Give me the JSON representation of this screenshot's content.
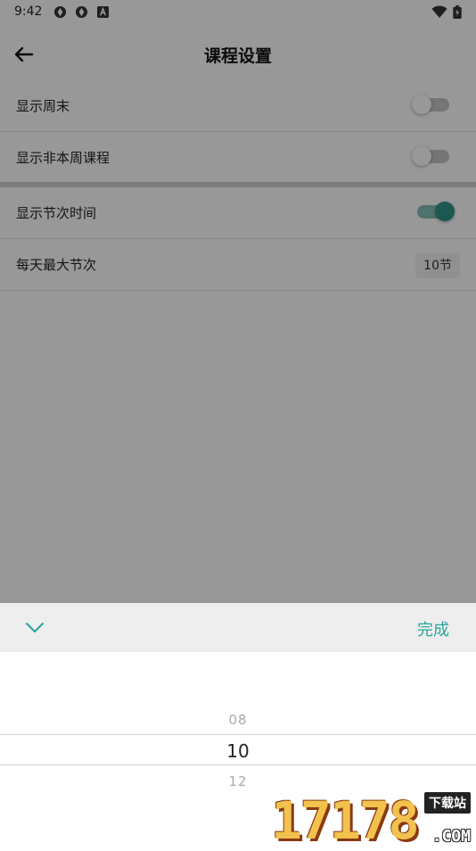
{
  "status_bar": {
    "time": "9:42",
    "icons": [
      "notification-icon",
      "notification-icon",
      "a-letter-icon",
      "wifi-icon",
      "battery-icon"
    ]
  },
  "app_bar": {
    "back_icon": "arrow-left-icon",
    "title": "课程设置"
  },
  "settings": [
    {
      "label": "显示周末",
      "type": "switch",
      "checked": false
    },
    {
      "label": "显示非本周课程",
      "type": "switch",
      "checked": false
    },
    {
      "label": "显示节次时间",
      "type": "switch",
      "checked": true
    },
    {
      "label": "每天最大节次",
      "type": "value",
      "value": "10节"
    }
  ],
  "picker_sheet": {
    "collapse_icon": "chevron-down-icon",
    "done_label": "完成",
    "options": [
      "08",
      "10",
      "12"
    ],
    "selected": "10"
  },
  "watermark": {
    "number": "17178",
    "tag": "下载站",
    "suffix": ".COM"
  },
  "colors": {
    "accent": "#26a69a",
    "switch_on": "#2a8f84",
    "overlay": "rgba(0,0,0,0.38)"
  }
}
